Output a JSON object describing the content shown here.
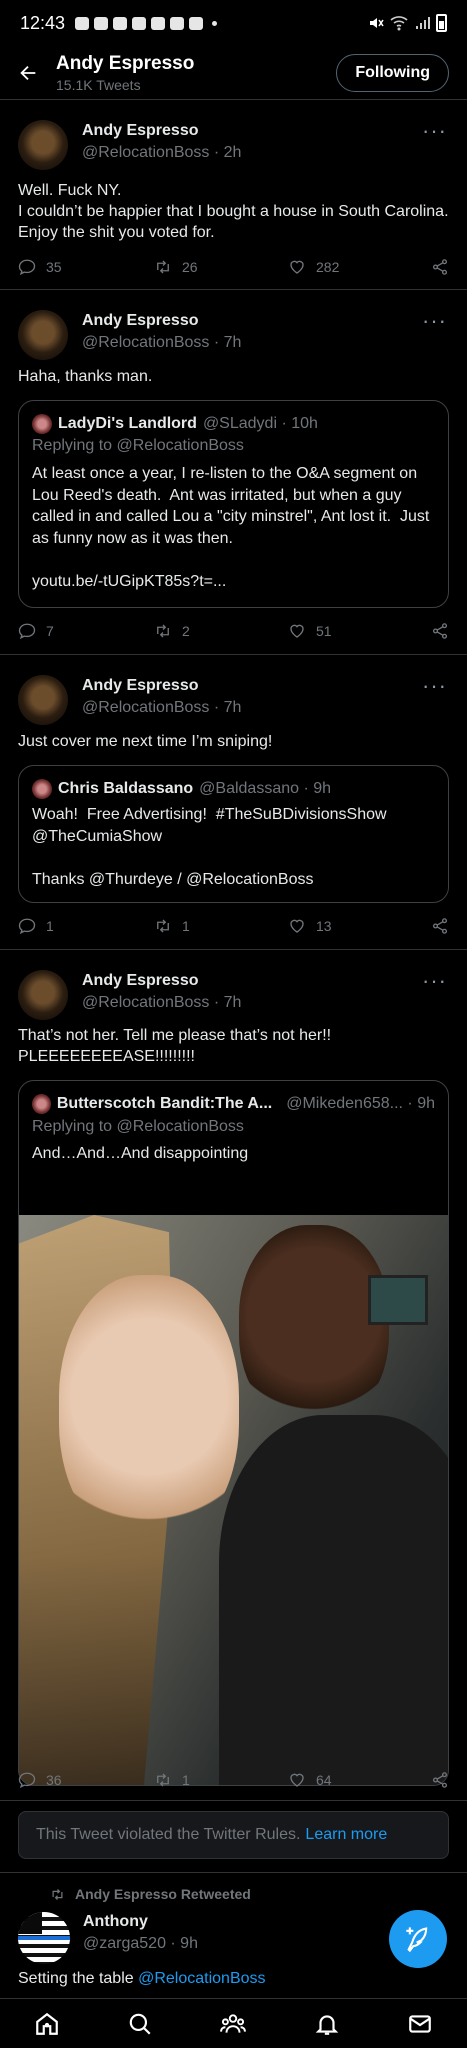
{
  "status_bar": {
    "time": "12:43"
  },
  "header": {
    "name": "Andy Espresso",
    "tweet_count": "15.1K Tweets",
    "follow_label": "Following"
  },
  "tweets": [
    {
      "name": "Andy Espresso",
      "handle": "@RelocationBoss · 2h",
      "text": "Well. Fuck NY.\nI couldn’t be happier that I bought a house in South Carolina.\nEnjoy the shit you voted for.",
      "replies": "35",
      "retweets": "26",
      "likes": "282"
    },
    {
      "name": "Andy Espresso",
      "handle": "@RelocationBoss · 7h",
      "text": "Haha, thanks man.",
      "replies": "7",
      "retweets": "2",
      "likes": "51",
      "quote": {
        "name": "LadyDi's Landlord",
        "handle": "@SLadydi · 10h",
        "replying": "Replying to @RelocationBoss",
        "text": "At least once a year, I re-listen to the O&A segment on Lou Reed's death.  Ant was irritated, but when a guy called in and called Lou a \"city minstrel\", Ant lost it.  Just as funny now as it was then.\n\nyoutu.be/-tUGipKT85s?t=..."
      }
    },
    {
      "name": "Andy Espresso",
      "handle": "@RelocationBoss · 7h",
      "text": "Just cover me next time I’m sniping!",
      "replies": "1",
      "retweets": "1",
      "likes": "13",
      "quote": {
        "name": "Chris Baldassano",
        "handle": "@Baldassano · 9h",
        "text": "Woah!  Free Advertising!  #TheSuBDivisionsShow\n@TheCumiaShow\n\nThanks @Thurdeye / @RelocationBoss"
      }
    },
    {
      "name": "Andy Espresso",
      "handle": "@RelocationBoss · 7h",
      "text": "That’s not her. Tell me please that’s not her!!\nPLEEEEEEEEASE!!!!!!!!!",
      "replies": "36",
      "retweets": "1",
      "likes": "64",
      "quote": {
        "name": "Butterscotch Bandit:The A...",
        "handle": "@Mikeden658... · 9h",
        "replying": "Replying to @RelocationBoss",
        "text": "And…And…And disappointing"
      }
    }
  ],
  "violation": {
    "text": "This Tweet violated the Twitter Rules.",
    "link": "Learn more"
  },
  "retweet": {
    "label": "Andy Espresso Retweeted",
    "name": "Anthony",
    "handle": "@zarga520 · 9h",
    "text": "Setting the table",
    "mention": "@RelocationBoss"
  },
  "colors": {
    "accent": "#1d9bf0",
    "background": "#000000",
    "muted": "#71767b"
  }
}
